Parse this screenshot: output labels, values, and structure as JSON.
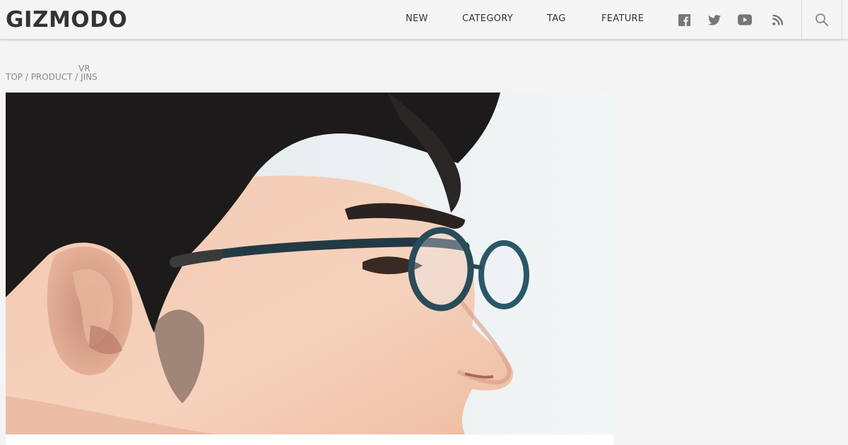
{
  "header": {
    "logo": "GIZMODO",
    "nav": [
      {
        "label": "NEW"
      },
      {
        "label": "CATEGORY"
      },
      {
        "label": "TAG"
      },
      {
        "label": "FEATURE"
      }
    ],
    "social_icons": [
      "facebook-icon",
      "twitter-icon",
      "youtube-icon",
      "rss-icon"
    ],
    "search_icon": "search-icon"
  },
  "breadcrumb": {
    "top": "TOP",
    "sep1": " / ",
    "product": "PRODUCT",
    "sep2": " / ",
    "vr": "VR",
    "jins": "JINS"
  },
  "colors": {
    "background": "#f4f4f4",
    "header_bg": "#f5f5f5",
    "text": "#333333",
    "breadcrumb": "#888888",
    "icon": "#777777"
  }
}
